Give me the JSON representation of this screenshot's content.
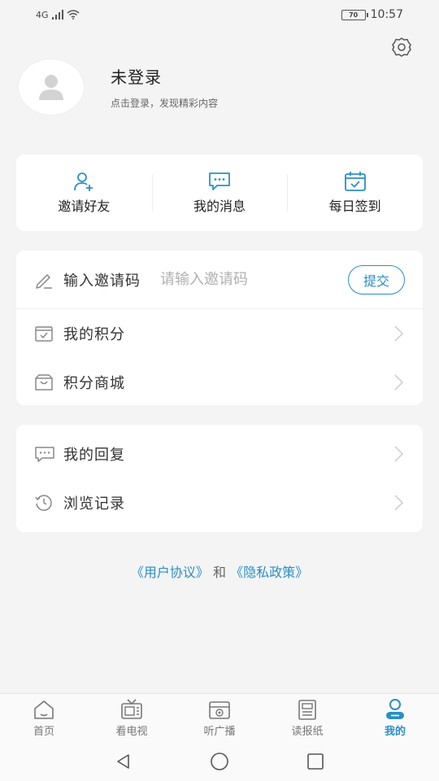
{
  "status_bar": {
    "network": "4G",
    "battery": "70",
    "time": "10:57"
  },
  "profile": {
    "name": "未登录",
    "hint": "点击登录，发现精彩内容"
  },
  "quick_actions": [
    {
      "label": "邀请好友",
      "icon": "invite-friend-icon"
    },
    {
      "label": "我的消息",
      "icon": "message-icon"
    },
    {
      "label": "每日签到",
      "icon": "calendar-check-icon"
    }
  ],
  "invite": {
    "label": "输入邀请码",
    "placeholder": "请输入邀请码",
    "submit": "提交"
  },
  "menu_group_1": [
    {
      "label": "我的积分",
      "icon": "points-icon"
    },
    {
      "label": "积分商城",
      "icon": "mall-icon"
    }
  ],
  "menu_group_2": [
    {
      "label": "我的回复",
      "icon": "reply-icon"
    },
    {
      "label": "浏览记录",
      "icon": "history-icon"
    }
  ],
  "agreement": {
    "user_agreement": "《用户协议》",
    "and": "和",
    "privacy_policy": "《隐私政策》"
  },
  "tabs": [
    {
      "label": "首页",
      "icon": "home-icon",
      "active": false
    },
    {
      "label": "看电视",
      "icon": "tv-icon",
      "active": false
    },
    {
      "label": "听广播",
      "icon": "radio-icon",
      "active": false
    },
    {
      "label": "读报纸",
      "icon": "newspaper-icon",
      "active": false
    },
    {
      "label": "我的",
      "icon": "user-icon",
      "active": true
    }
  ],
  "colors": {
    "accent": "#2a8fc7",
    "background": "#f4f4f4"
  }
}
